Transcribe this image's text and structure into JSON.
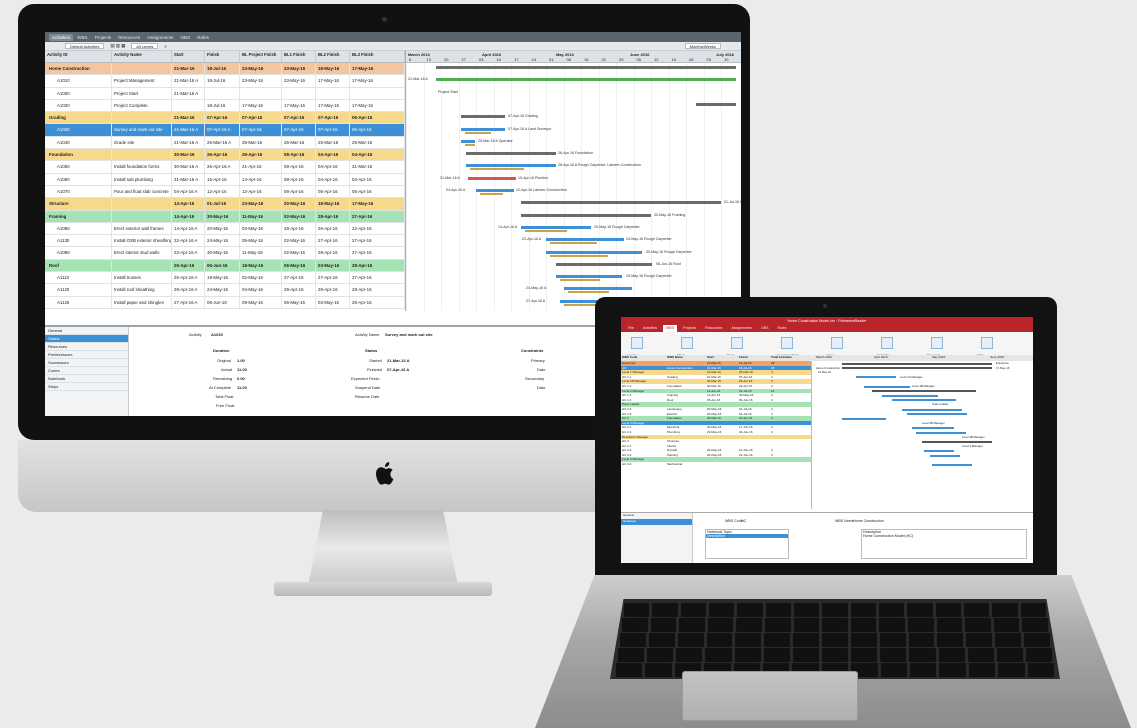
{
  "imac": {
    "tabs": [
      "Activities",
      "WBS",
      "Projects",
      "Resources",
      "Assignments",
      "OBS",
      "Roles"
    ],
    "toolbar": {
      "layout": "Default Activities",
      "levels": "All Levels",
      "zoom": "Months/Weeks"
    },
    "columns": [
      "Activity ID",
      "Activity Name",
      "Start",
      "Finish",
      "BL Project Finish",
      "BL1 Finish",
      "BL2 Finish",
      "BL3 Finish"
    ],
    "rows": [
      {
        "id": "Home Construction",
        "name": "",
        "start": "21-Mar-16",
        "finish": "18-Jul-16",
        "b1": "23-May-16",
        "b2": "23-May-16",
        "b3": "18-May-16",
        "b4": "17-May-16",
        "type": "wbs",
        "color": "#f4c6a0"
      },
      {
        "id": "A1010",
        "name": "Project Management",
        "start": "21-Mar-16 A",
        "finish": "18-Jul-16",
        "b1": "23-May-16",
        "b2": "23-May-16",
        "b3": "17-May-16",
        "b4": "17-May-16",
        "type": "act"
      },
      {
        "id": "A1000",
        "name": "Project Start",
        "start": "21-Mar-16 A",
        "finish": "",
        "b1": "",
        "b2": "",
        "b3": "",
        "b4": "",
        "type": "act"
      },
      {
        "id": "A1020",
        "name": "Project Complete",
        "start": "",
        "finish": "18-Jul-16",
        "b1": "17-May-16",
        "b2": "17-May-16",
        "b3": "17-May-16",
        "b4": "17-May-16",
        "type": "act"
      },
      {
        "id": "Grading",
        "name": "",
        "start": "21-Mar-16",
        "finish": "07-Apr-16",
        "b1": "07-Apr-16",
        "b2": "07-Apr-16",
        "b3": "07-Apr-16",
        "b4": "06-Apr-16",
        "type": "wbs",
        "color": "#f7d98c"
      },
      {
        "id": "A1030",
        "name": "Survey and mark out site",
        "start": "21-Mar-16 A",
        "finish": "07-Apr-16 A",
        "b1": "07-Apr-16",
        "b2": "07-Apr-16",
        "b3": "07-Apr-16",
        "b4": "06-Apr-16",
        "type": "sel"
      },
      {
        "id": "A1040",
        "name": "Grade site",
        "start": "21-Mar-16 A",
        "finish": "25-Mar-16 A",
        "b1": "25-Mar-16",
        "b2": "25-Mar-16",
        "b3": "25-Mar-16",
        "b4": "25-Mar-16",
        "type": "act"
      },
      {
        "id": "Foundation",
        "name": "",
        "start": "30-Mar-16",
        "finish": "26-Apr-16",
        "b1": "26-Apr-16",
        "b2": "08-Apr-16",
        "b3": "04-Apr-16",
        "b4": "04-Apr-16",
        "type": "wbs",
        "color": "#f7d98c"
      },
      {
        "id": "A1050",
        "name": "Install foundation forms",
        "start": "30-Mar-16 A",
        "finish": "26-Apr-16 A",
        "b1": "21-Apr-16",
        "b2": "08-Apr-16",
        "b3": "04-Apr-16",
        "b4": "31-Mar-16",
        "type": "act"
      },
      {
        "id": "A1060",
        "name": "Install sub plumbing",
        "start": "31-Mar-16 A",
        "finish": "15-Apr-16",
        "b1": "14-Apr-16",
        "b2": "08-Apr-16",
        "b3": "04-Apr-16",
        "b4": "04-Apr-16",
        "type": "act"
      },
      {
        "id": "A1070",
        "name": "Pour and float slab concrete",
        "start": "04-Apr-16 A",
        "finish": "12-Apr-16",
        "b1": "12-Apr-16",
        "b2": "08-Apr-16",
        "b3": "05-Apr-16",
        "b4": "05-Apr-16",
        "type": "act"
      },
      {
        "id": "Structure",
        "name": "",
        "start": "14-Apr-16",
        "finish": "01-Jul-16",
        "b1": "23-May-16",
        "b2": "20-May-16",
        "b3": "18-May-16",
        "b4": "17-May-16",
        "type": "wbs",
        "color": "#f7d98c"
      },
      {
        "id": "Framing",
        "name": "",
        "start": "14-Apr-16",
        "finish": "30-May-16",
        "b1": "11-May-16",
        "b2": "02-May-16",
        "b3": "28-Apr-16",
        "b4": "27-Apr-16",
        "type": "wbs",
        "color": "#a5e3b5"
      },
      {
        "id": "A1080",
        "name": "Erect exterior wall frames",
        "start": "14-Apr-16 A",
        "finish": "20-May-16",
        "b1": "03-May-16",
        "b2": "28-Apr-16",
        "b3": "26-Apr-16",
        "b4": "22-Apr-16",
        "type": "act"
      },
      {
        "id": "A1130",
        "name": "Install OSB exterior sheathing",
        "start": "22-Apr-16 A",
        "finish": "24-May-16",
        "b1": "05-May-16",
        "b2": "02-May-16",
        "b3": "27-Apr-16",
        "b4": "27-Apr-16",
        "type": "act"
      },
      {
        "id": "A1090",
        "name": "Erect interior stud walls",
        "start": "22-Apr-16 A",
        "finish": "30-May-16",
        "b1": "11-May-16",
        "b2": "02-May-16",
        "b3": "28-Apr-16",
        "b4": "27-Apr-16",
        "type": "act"
      },
      {
        "id": "Roof",
        "name": "",
        "start": "25-Apr-16",
        "finish": "06-Jun-16",
        "b1": "18-May-16",
        "b2": "06-May-16",
        "b3": "03-May-16",
        "b4": "28-Apr-16",
        "type": "wbs",
        "color": "#a5e3b5"
      },
      {
        "id": "A1110",
        "name": "Install trusses",
        "start": "25-Apr-16 A",
        "finish": "19-May-16",
        "b1": "02-May-16",
        "b2": "27-Apr-16",
        "b3": "27-Apr-16",
        "b4": "27-Apr-16",
        "type": "act"
      },
      {
        "id": "A1120",
        "name": "Install roof sheathing",
        "start": "28-Apr-16 A",
        "finish": "24-May-16",
        "b1": "04-May-16",
        "b2": "29-Apr-16",
        "b3": "29-Apr-16",
        "b4": "28-Apr-16",
        "type": "act"
      },
      {
        "id": "A1125",
        "name": "Install paper and shingles",
        "start": "27-Apr-16 A",
        "finish": "06-Jun-16",
        "b1": "09-May-16",
        "b2": "06-May-16",
        "b3": "03-May-16",
        "b4": "28-Apr-16",
        "type": "act"
      }
    ],
    "months": [
      "March 2016",
      "April 2016",
      "May 2016",
      "June 2016",
      "July 2016"
    ],
    "weeks": [
      "6",
      "13",
      "20",
      "27",
      "03",
      "10",
      "17",
      "24",
      "01",
      "08",
      "15",
      "22",
      "29",
      "05",
      "12",
      "19",
      "26",
      "03",
      "10"
    ],
    "gantt_labels": [
      "21-Mar-16 A",
      "Project Start",
      "07-Apr-16  Grading",
      "07-Apr-16 A  Land Surveyor",
      "25-Mar-16 A  Operator",
      "26-Apr-16  Foundation",
      "26-Apr-16 A  Rough Carpenter, Laborer-Construction",
      "31-Mar-16 A",
      "15-Apr-16  Plumber",
      "04-Apr-16 A",
      "12-Apr-16  Laborer-Construction",
      "01-Jul-16  Structure",
      "30-May-16  Framing",
      "14-Apr-16 A",
      "20-May-16  Rough Carpenter",
      "22-Apr-16 A",
      "24-May-16  Rough Carpenter",
      "30-May-16  Rough Carpenter",
      "06-Jun-16  Roof",
      "19-May-16  Rough Carpenter",
      "24-May-16 A",
      "27-Apr-16 A"
    ],
    "bottom_tabs": [
      "General",
      "Status",
      "Resources",
      "Predecessors",
      "Successors",
      "Codes",
      "Notebook",
      "Steps"
    ],
    "details": {
      "activity_label": "Activity",
      "activity": "A1030",
      "activity_name_label": "Activity Name",
      "activity_name": "Survey and mark out site",
      "duration_header": "Duration",
      "status_header": "Status",
      "constraints_header": "Constraints",
      "original_label": "Original",
      "original": "1.00",
      "actual_label": "Actual",
      "actual": "11.00",
      "remaining_label": "Remaining",
      "remaining": "0.00",
      "at_complete_label": "At Complete",
      "at_complete": "11.00",
      "total_float_label": "Total Float",
      "free_float_label": "Free Float",
      "started_label": "Started",
      "started": "21-Mar-16 A",
      "finished_label": "Finished",
      "finished": "07-Apr-16 A",
      "exp_finish_label": "Expected Finish",
      "suspend_label": "Suspend Date",
      "resume_label": "Resume Date",
      "primary_label": "Primary",
      "date_label": "Date",
      "secondary_label": "Secondary",
      "date2_label": "Date"
    }
  },
  "laptop": {
    "title": "Home Construction Model.xer - PrimaveraReader",
    "tabs": [
      "File",
      "Activities",
      "WBS",
      "Projects",
      "Resources",
      "Assignments",
      "OBS",
      "Roles"
    ],
    "ribbon": [
      "Layout",
      "Filters",
      "Tools",
      "Expand Collapse",
      "View",
      "Calendar",
      "Timescale",
      "Find"
    ],
    "columns": [
      "WBS Code",
      "WBS Name",
      "Start",
      "Finish",
      "Total Activities"
    ],
    "rows": [
      {
        "code": "Enterprise",
        "name": "",
        "start": "21-Mar-16",
        "finish": "18-Jul-16",
        "n": "28",
        "color": "#f5a35f"
      },
      {
        "code": "HC",
        "name": "Home Construction",
        "start": "21-Mar-16",
        "finish": "18-Jul-16",
        "n": "28",
        "color": "#3d8fd8"
      },
      {
        "code": "Level 1 Manager",
        "name": "",
        "start": "21-Mar-16",
        "finish": "25-Mar-16",
        "n": "4",
        "color": "#f7d98c"
      },
      {
        "code": "HC.1.1",
        "name": "Grading",
        "start": "21-Mar-16",
        "finish": "07-Apr-16",
        "n": "2",
        "color": ""
      },
      {
        "code": "Level 1B Manager",
        "name": "",
        "start": "30-Mar-16",
        "finish": "26-Apr-16",
        "n": "3",
        "color": "#f7d98c"
      },
      {
        "code": "HC.1.2",
        "name": "Foundation",
        "start": "30-Mar-16",
        "finish": "26-Apr-16",
        "n": "3",
        "color": ""
      },
      {
        "code": "Level 2 Manager",
        "name": "",
        "start": "14-Apr-16",
        "finish": "01-Jul-16",
        "n": "14",
        "color": "#a5e3b5"
      },
      {
        "code": "HC.1.3",
        "name": "Framing",
        "start": "14-Apr-16",
        "finish": "30-May-16",
        "n": "3",
        "color": ""
      },
      {
        "code": "HC.1.4",
        "name": "Roof",
        "start": "25-Apr-16",
        "finish": "06-Jun-16",
        "n": "3",
        "color": ""
      },
      {
        "code": "Team Leader",
        "name": "",
        "start": "",
        "finish": "",
        "n": "",
        "color": "#a5e3b5"
      },
      {
        "code": "HC.1.5",
        "name": "Landscape",
        "start": "20-May-16",
        "finish": "01-Jul-16",
        "n": "4",
        "color": ""
      },
      {
        "code": "HC.1.6",
        "name": "Exterior",
        "start": "20-May-16",
        "finish": "01-Jul-16",
        "n": "4",
        "color": ""
      },
      {
        "code": "HC.2",
        "name": "Foundation",
        "start": "30-Mar-16",
        "finish": "26-Apr-16",
        "n": "3",
        "color": "#a5e3b5"
      },
      {
        "code": "Level 3 Manager",
        "name": "",
        "start": "",
        "finish": "",
        "n": "",
        "color": "#3d8fd8"
      },
      {
        "code": "HC.2.1",
        "name": "Electrical",
        "start": "20-May-16",
        "finish": "17-Jun-16",
        "n": "3",
        "color": ""
      },
      {
        "code": "HC.2.2",
        "name": "Plumbing",
        "start": "23-May-16",
        "finish": "30-Jun-16",
        "n": "3",
        "color": ""
      },
      {
        "code": "Developer Manager",
        "name": "",
        "start": "",
        "finish": "",
        "n": "",
        "color": "#f7d98c"
      },
      {
        "code": "HC.3",
        "name": "Structure",
        "start": "",
        "finish": "",
        "n": "",
        "color": ""
      },
      {
        "code": "HC.3.1",
        "name": "Interior",
        "start": "",
        "finish": "",
        "n": "",
        "color": ""
      },
      {
        "code": "HC.3.2",
        "name": "Drywall",
        "start": "20-May-16",
        "finish": "10-Jun-16",
        "n": "3",
        "color": ""
      },
      {
        "code": "HC.3.3",
        "name": "Painting",
        "start": "26-May-16",
        "finish": "15-Jun-16",
        "n": "3",
        "color": ""
      },
      {
        "code": "Level 2 Manager",
        "name": "",
        "start": "",
        "finish": "",
        "n": "",
        "color": "#a5e3b5"
      },
      {
        "code": "HC.3.4",
        "name": "Mechanical",
        "start": "",
        "finish": "",
        "n": "",
        "color": ""
      }
    ],
    "months": [
      "March 2016",
      "April 2016",
      "May 2016",
      "June 2016"
    ],
    "gantt_labels": [
      "Enterprise",
      "17-May-16",
      "Home Construction",
      "21-Mar-16",
      "Level 1A Manager",
      "Level 1B Manager",
      "Team Leader",
      "Level 2B Manager",
      "Level 3B Manager",
      "Level 2 Manager"
    ],
    "bottom_tabs": [
      "General",
      "Notebook"
    ],
    "detail": {
      "wbs_code_label": "WBS Code",
      "wbs_code": "HC",
      "wbs_name_label": "WBS Name",
      "wbs_name": "Home Construction",
      "notebook_topic": "Notebook Topic",
      "topic_selected": "Description",
      "description_label": "Description",
      "description": "Home Construction Model (HC)"
    }
  }
}
